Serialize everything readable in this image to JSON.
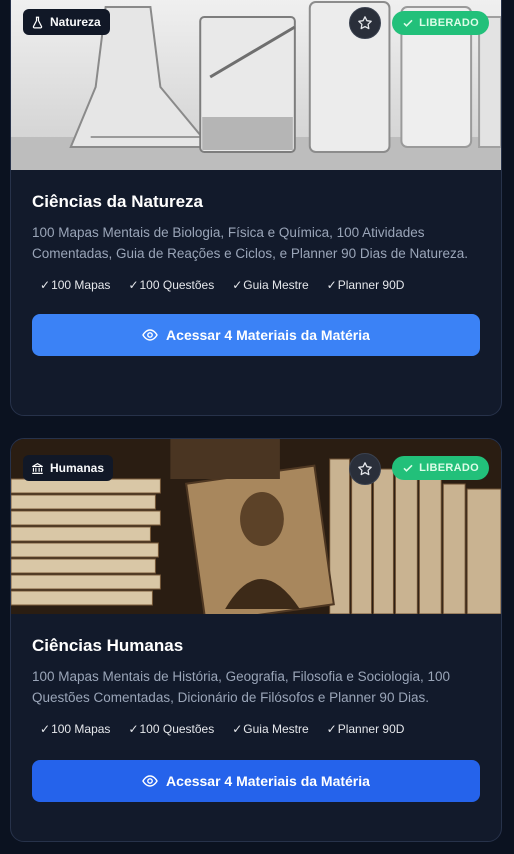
{
  "cards": [
    {
      "tag": "Natureza",
      "tag_icon": "flask-icon",
      "badge": "LIBERADO",
      "title": "Ciências da Natureza",
      "description": "100 Mapas Mentais de Biologia, Física e Química, 100 Atividades Comentadas, Guia de Reações e Ciclos, e Planner 90 Dias de Natureza.",
      "features": [
        "100 Mapas",
        "100 Questões",
        "Guia Mestre",
        "Planner 90D"
      ],
      "cta": "Acessar 4 Materiais da Matéria"
    },
    {
      "tag": "Humanas",
      "tag_icon": "landmark-icon",
      "badge": "LIBERADO",
      "title": "Ciências Humanas",
      "description": "100 Mapas Mentais de História, Geografia, Filosofia e Sociologia, 100 Questões Comentadas, Dicionário de Filósofos e Planner 90 Dias.",
      "features": [
        "100 Mapas",
        "100 Questões",
        "Guia Mestre",
        "Planner 90D"
      ],
      "cta": "Acessar 4 Materiais da Matéria"
    }
  ],
  "feature_check": "✓",
  "colors": {
    "background": "#0b1220",
    "card": "#121a2b",
    "badge": "#22c07a",
    "cta_primary": "#3b82f6",
    "cta_secondary": "#2563eb"
  }
}
